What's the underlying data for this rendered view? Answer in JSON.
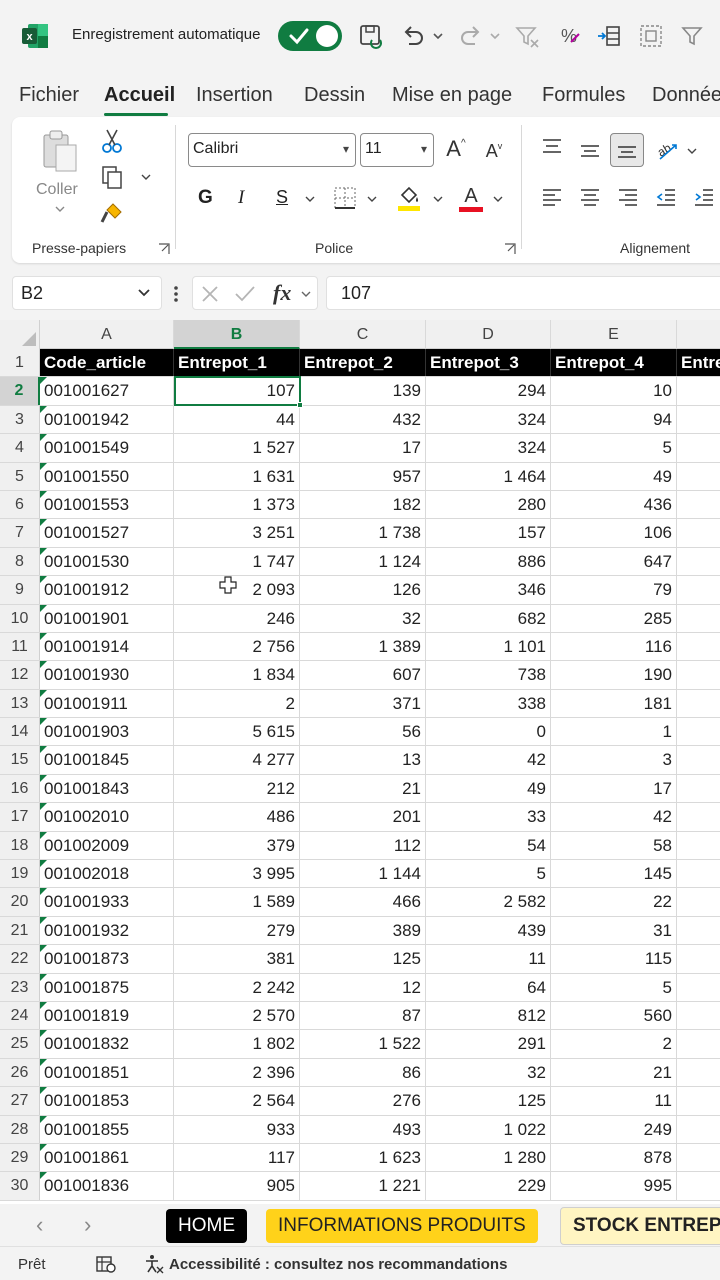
{
  "titlebar": {
    "autosave_label": "Enregistrement automatique",
    "autosave_on": true
  },
  "menu": {
    "tabs": [
      "Fichier",
      "Accueil",
      "Insertion",
      "Dessin",
      "Mise en page",
      "Formules",
      "Données"
    ],
    "active": "Accueil"
  },
  "ribbon": {
    "paste_label": "Coller",
    "clipboard_group": "Presse-papiers",
    "font_group": "Police",
    "alignment_group": "Alignement",
    "font_name": "Calibri",
    "font_size": "11",
    "bold_label": "G",
    "italic_label": "I",
    "underline_label": "S",
    "grow_font": "A",
    "shrink_font": "A",
    "font_color_letter": "A",
    "font_color": "#e81123",
    "highlight_color": "#ffe600"
  },
  "formula_bar": {
    "name_box": "B2",
    "fx_label": "fx",
    "value": "107"
  },
  "grid": {
    "column_letters": [
      "A",
      "B",
      "C",
      "D",
      "E"
    ],
    "selected_column": "B",
    "selected_row": 2,
    "header_row_number": 1,
    "headers": [
      "Code_article",
      "Entrepot_1",
      "Entrepot_2",
      "Entrepot_3",
      "Entrepot_4",
      "Entre"
    ],
    "rows": [
      [
        "001001627",
        "107",
        "139",
        "294",
        "10"
      ],
      [
        "001001942",
        "44",
        "432",
        "324",
        "94"
      ],
      [
        "001001549",
        "1 527",
        "17",
        "324",
        "5"
      ],
      [
        "001001550",
        "1 631",
        "957",
        "1 464",
        "49"
      ],
      [
        "001001553",
        "1 373",
        "182",
        "280",
        "436"
      ],
      [
        "001001527",
        "3 251",
        "1 738",
        "157",
        "106"
      ],
      [
        "001001530",
        "1 747",
        "1 124",
        "886",
        "647"
      ],
      [
        "001001912",
        "2 093",
        "126",
        "346",
        "79"
      ],
      [
        "001001901",
        "246",
        "32",
        "682",
        "285"
      ],
      [
        "001001914",
        "2 756",
        "1 389",
        "1 101",
        "116"
      ],
      [
        "001001930",
        "1 834",
        "607",
        "738",
        "190"
      ],
      [
        "001001911",
        "2",
        "371",
        "338",
        "181"
      ],
      [
        "001001903",
        "5 615",
        "56",
        "0",
        "1"
      ],
      [
        "001001845",
        "4 277",
        "13",
        "42",
        "3"
      ],
      [
        "001001843",
        "212",
        "21",
        "49",
        "17"
      ],
      [
        "001002010",
        "486",
        "201",
        "33",
        "42"
      ],
      [
        "001002009",
        "379",
        "112",
        "54",
        "58"
      ],
      [
        "001002018",
        "3 995",
        "1 144",
        "5",
        "145"
      ],
      [
        "001001933",
        "1 589",
        "466",
        "2 582",
        "22"
      ],
      [
        "001001932",
        "279",
        "389",
        "439",
        "31"
      ],
      [
        "001001873",
        "381",
        "125",
        "11",
        "115"
      ],
      [
        "001001875",
        "2 242",
        "12",
        "64",
        "5"
      ],
      [
        "001001819",
        "2 570",
        "87",
        "812",
        "560"
      ],
      [
        "001001832",
        "1 802",
        "1 522",
        "291",
        "2"
      ],
      [
        "001001851",
        "2 396",
        "86",
        "32",
        "21"
      ],
      [
        "001001853",
        "2 564",
        "276",
        "125",
        "11"
      ],
      [
        "001001855",
        "933",
        "493",
        "1 022",
        "249"
      ],
      [
        "001001861",
        "117",
        "1 623",
        "1 280",
        "878"
      ],
      [
        "001001836",
        "905",
        "1 221",
        "229",
        "995"
      ]
    ]
  },
  "sheets": {
    "home": "HOME",
    "info": "INFORMATIONS PRODUITS",
    "stock": "STOCK ENTREPOTS"
  },
  "status": {
    "ready": "Prêt",
    "accessibility": "Accessibilité : consultez nos recommandations"
  }
}
